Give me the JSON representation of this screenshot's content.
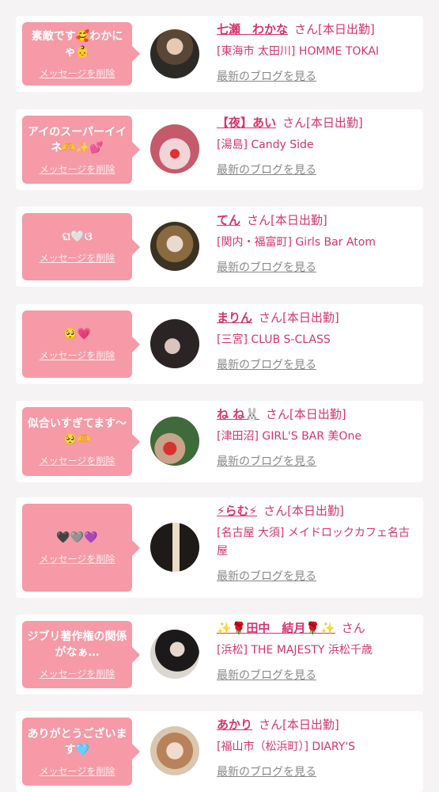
{
  "colors": {
    "accent": "#d6356b",
    "bubble": "#f59aa6",
    "background": "#f5f3f3"
  },
  "cards": [
    {
      "message": "素敵です🥰わかにゃ👶",
      "delete_label": "メッセージを削除",
      "name": "七瀬　わかな",
      "san": "さん[本日出勤]",
      "shop": "[東海市 太田川] HOMME TOKAI",
      "blog": "最新のブログを見る",
      "avatar_icon": "avatar-photo"
    },
    {
      "message": "アイのスーパーイイネ🫶✨💕",
      "delete_label": "メッセージを削除",
      "name": "【夜】あい",
      "san": "さん[本日出勤]",
      "shop": "[湯島] Candy Side",
      "blog": "最新のブログを見る",
      "avatar_icon": "avatar-photo"
    },
    {
      "message": "ଘ🤍ଓ",
      "delete_label": "メッセージを削除",
      "name": "てん",
      "san": "さん[本日出勤]",
      "shop": "[関内・福富町] Girls Bar Atom",
      "blog": "最新のブログを見る",
      "avatar_icon": "avatar-photo"
    },
    {
      "message": "🥺💗",
      "delete_label": "メッセージを削除",
      "name": "まりん",
      "san": "さん[本日出勤]",
      "shop": "[三宮] CLUB S-CLASS",
      "blog": "最新のブログを見る",
      "avatar_icon": "avatar-photo"
    },
    {
      "message": "似合いすぎてます〜🥺🫶",
      "delete_label": "メッセージを削除",
      "name": "ね ね🐰",
      "san": "さん[本日出勤]",
      "shop": "[津田沼] GIRL'S BAR 美One",
      "blog": "最新のブログを見る",
      "avatar_icon": "avatar-photo"
    },
    {
      "message": "🖤🩶💜",
      "delete_label": "メッセージを削除",
      "name": "⚡らむ⚡",
      "san": "さん[本日出勤]",
      "shop": "[名古屋 大須] メイドロックカフェ名古屋",
      "blog": "最新のブログを見る",
      "avatar_icon": "avatar-photo"
    },
    {
      "message": "ジブリ著作権の関係がなぁ…",
      "delete_label": "メッセージを削除",
      "name": "✨🌹田中　結月🌹✨",
      "san": "さん",
      "shop": "[浜松] THE MAJESTY 浜松千歳",
      "blog": "最新のブログを見る",
      "avatar_icon": "avatar-photo"
    },
    {
      "message": "ありがとうございます🩵",
      "delete_label": "メッセージを削除",
      "name": "あかり",
      "san": "さん[本日出勤]",
      "shop": "[福山市（松浜町）] DIARY'S",
      "blog": "最新のブログを見る",
      "avatar_icon": "avatar-photo"
    }
  ]
}
